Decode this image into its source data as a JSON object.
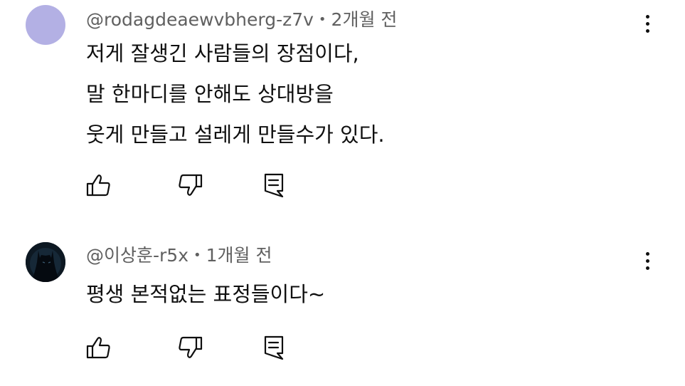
{
  "comments": [
    {
      "author": "@rodagdeaewvbherg-z7v",
      "separator": "•",
      "time": "2개월 전",
      "avatar_color": "#b3b0e4",
      "lines": [
        "저게 잘생긴 사람들의 장점이다,",
        "말 한마디를 안해도 상대방을",
        "웃게 만들고 설레게 만들수가 있다."
      ],
      "actions": {
        "like_icon": "thumbs-up-icon",
        "dislike_icon": "thumbs-down-icon",
        "reply_icon": "reply-icon"
      }
    },
    {
      "author": "@이상훈-r5x",
      "separator": "•",
      "time": "1개월 전",
      "avatar_color": "#0d1822",
      "lines": [
        "평생 본적없는 표정들이다~"
      ],
      "actions": {
        "like_icon": "thumbs-up-icon",
        "dislike_icon": "thumbs-down-icon",
        "reply_icon": "reply-icon"
      }
    }
  ]
}
